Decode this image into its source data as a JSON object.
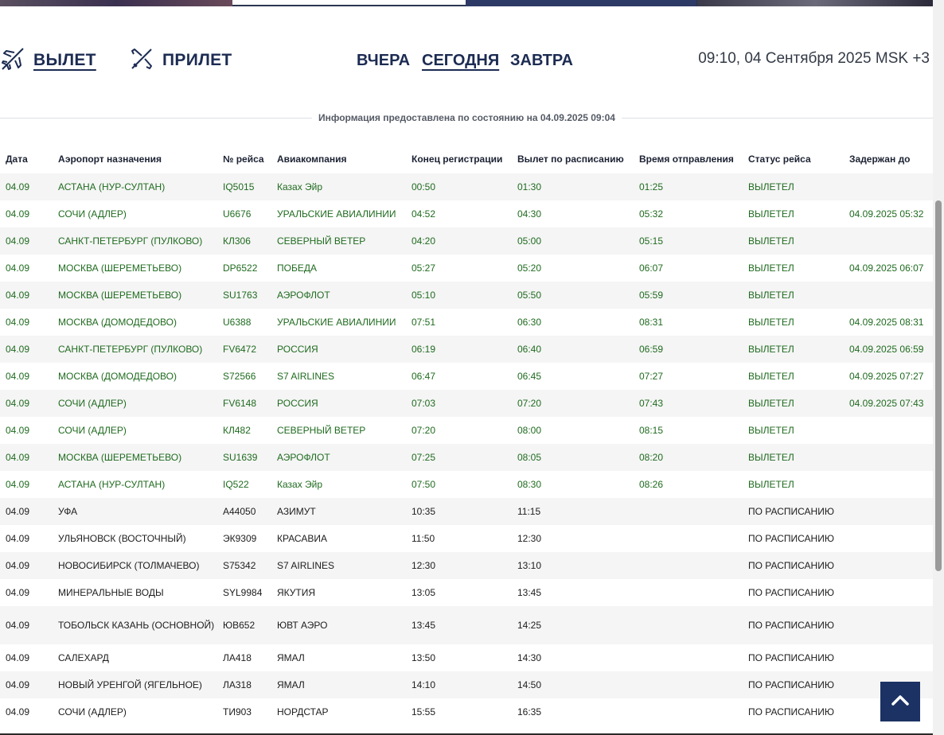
{
  "nav": {
    "departures_label": "ВЫЛЕТ",
    "arrivals_label": "ПРИЛЕТ",
    "days": {
      "yesterday": "ВЧЕРА",
      "today": "СЕГОДНЯ",
      "tomorrow": "ЗАВТРА"
    },
    "clock": "09:10, 04 Сентября 2025 MSK +3"
  },
  "info": "Информация предоставлена по состоянию на 04.09.2025 09:04",
  "table": {
    "headers": {
      "date": "Дата",
      "destination": "Аэропорт назначения",
      "flight": "№ рейса",
      "airline": "Авиакомпания",
      "checkin_end": "Конец регистрации",
      "scheduled": "Вылет по расписанию",
      "actual": "Время отправления",
      "status": "Статус рейса",
      "delayed": "Задержан до"
    },
    "rows": [
      {
        "date": "04.09",
        "destination": "АСТАНА (НУР-СУЛТАН)",
        "flight": "IQ5015",
        "airline": "Казах Эйр",
        "checkin_end": "00:50",
        "scheduled": "01:30",
        "actual": "01:25",
        "status": "ВЫЛЕТЕЛ",
        "delayed": "",
        "departed": true
      },
      {
        "date": "04.09",
        "destination": "СОЧИ (АДЛЕР)",
        "flight": "U6676",
        "airline": "УРАЛЬСКИЕ АВИАЛИНИИ",
        "checkin_end": "04:52",
        "scheduled": "04:30",
        "actual": "05:32",
        "status": "ВЫЛЕТЕЛ",
        "delayed": "04.09.2025 05:32",
        "departed": true
      },
      {
        "date": "04.09",
        "destination": "САНКТ-ПЕТЕРБУРГ (ПУЛКОВО)",
        "flight": "КЛ306",
        "airline": "СЕВЕРНЫЙ ВЕТЕР",
        "checkin_end": "04:20",
        "scheduled": "05:00",
        "actual": "05:15",
        "status": "ВЫЛЕТЕЛ",
        "delayed": "",
        "departed": true
      },
      {
        "date": "04.09",
        "destination": "МОСКВА (ШЕРЕМЕТЬЕВО)",
        "flight": "DP6522",
        "airline": "ПОБЕДА",
        "checkin_end": "05:27",
        "scheduled": "05:20",
        "actual": "06:07",
        "status": "ВЫЛЕТЕЛ",
        "delayed": "04.09.2025 06:07",
        "departed": true
      },
      {
        "date": "04.09",
        "destination": "МОСКВА (ШЕРЕМЕТЬЕВО)",
        "flight": "SU1763",
        "airline": "АЭРОФЛОТ",
        "checkin_end": "05:10",
        "scheduled": "05:50",
        "actual": "05:59",
        "status": "ВЫЛЕТЕЛ",
        "delayed": "",
        "departed": true
      },
      {
        "date": "04.09",
        "destination": "МОСКВА (ДОМОДЕДОВО)",
        "flight": "U6388",
        "airline": "УРАЛЬСКИЕ АВИАЛИНИИ",
        "checkin_end": "07:51",
        "scheduled": "06:30",
        "actual": "08:31",
        "status": "ВЫЛЕТЕЛ",
        "delayed": "04.09.2025 08:31",
        "departed": true
      },
      {
        "date": "04.09",
        "destination": "САНКТ-ПЕТЕРБУРГ (ПУЛКОВО)",
        "flight": "FV6472",
        "airline": "РОССИЯ",
        "checkin_end": "06:19",
        "scheduled": "06:40",
        "actual": "06:59",
        "status": "ВЫЛЕТЕЛ",
        "delayed": "04.09.2025 06:59",
        "departed": true
      },
      {
        "date": "04.09",
        "destination": "МОСКВА (ДОМОДЕДОВО)",
        "flight": "S72566",
        "airline": "S7 AIRLINES",
        "checkin_end": "06:47",
        "scheduled": "06:45",
        "actual": "07:27",
        "status": "ВЫЛЕТЕЛ",
        "delayed": "04.09.2025 07:27",
        "departed": true
      },
      {
        "date": "04.09",
        "destination": "СОЧИ (АДЛЕР)",
        "flight": "FV6148",
        "airline": "РОССИЯ",
        "checkin_end": "07:03",
        "scheduled": "07:20",
        "actual": "07:43",
        "status": "ВЫЛЕТЕЛ",
        "delayed": "04.09.2025 07:43",
        "departed": true
      },
      {
        "date": "04.09",
        "destination": "СОЧИ (АДЛЕР)",
        "flight": "КЛ482",
        "airline": "СЕВЕРНЫЙ ВЕТЕР",
        "checkin_end": "07:20",
        "scheduled": "08:00",
        "actual": "08:15",
        "status": "ВЫЛЕТЕЛ",
        "delayed": "",
        "departed": true
      },
      {
        "date": "04.09",
        "destination": "МОСКВА (ШЕРЕМЕТЬЕВО)",
        "flight": "SU1639",
        "airline": "АЭРОФЛОТ",
        "checkin_end": "07:25",
        "scheduled": "08:05",
        "actual": "08:20",
        "status": "ВЫЛЕТЕЛ",
        "delayed": "",
        "departed": true
      },
      {
        "date": "04.09",
        "destination": "АСТАНА (НУР-СУЛТАН)",
        "flight": "IQ522",
        "airline": "Казах Эйр",
        "checkin_end": "07:50",
        "scheduled": "08:30",
        "actual": "08:26",
        "status": "ВЫЛЕТЕЛ",
        "delayed": "",
        "departed": true
      },
      {
        "date": "04.09",
        "destination": "УФА",
        "flight": "А44050",
        "airline": "АЗИМУТ",
        "checkin_end": "10:35",
        "scheduled": "11:15",
        "actual": "",
        "status": "ПО РАСПИСАНИЮ",
        "delayed": "",
        "departed": false
      },
      {
        "date": "04.09",
        "destination": "УЛЬЯНОВСК (ВОСТОЧНЫЙ)",
        "flight": "ЭК9309",
        "airline": "КРАСАВИА",
        "checkin_end": "11:50",
        "scheduled": "12:30",
        "actual": "",
        "status": "ПО РАСПИСАНИЮ",
        "delayed": "",
        "departed": false
      },
      {
        "date": "04.09",
        "destination": "НОВОСИБИРСК (ТОЛМАЧЕВО)",
        "flight": "S75342",
        "airline": "S7 AIRLINES",
        "checkin_end": "12:30",
        "scheduled": "13:10",
        "actual": "",
        "status": "ПО РАСПИСАНИЮ",
        "delayed": "",
        "departed": false
      },
      {
        "date": "04.09",
        "destination": "МИНЕРАЛЬНЫЕ ВОДЫ",
        "flight": "SYL9984",
        "airline": "ЯКУТИЯ",
        "checkin_end": "13:05",
        "scheduled": "13:45",
        "actual": "",
        "status": "ПО РАСПИСАНИЮ",
        "delayed": "",
        "departed": false
      },
      {
        "date": "04.09",
        "destination": "ТОБОЛЬСК КАЗАНЬ (ОСНОВНОЙ)",
        "flight": "ЮВ652",
        "airline": "ЮВТ АЭРО",
        "checkin_end": "13:45",
        "scheduled": "14:25",
        "actual": "",
        "status": "ПО РАСПИСАНИЮ",
        "delayed": "",
        "departed": false,
        "tall": true
      },
      {
        "date": "04.09",
        "destination": "САЛЕХАРД",
        "flight": "ЛА418",
        "airline": "ЯМАЛ",
        "checkin_end": "13:50",
        "scheduled": "14:30",
        "actual": "",
        "status": "ПО РАСПИСАНИЮ",
        "delayed": "",
        "departed": false
      },
      {
        "date": "04.09",
        "destination": "НОВЫЙ УРЕНГОЙ (ЯГЕЛЬНОЕ)",
        "flight": "ЛА318",
        "airline": "ЯМАЛ",
        "checkin_end": "14:10",
        "scheduled": "14:50",
        "actual": "",
        "status": "ПО РАСПИСАНИЮ",
        "delayed": "",
        "departed": false
      },
      {
        "date": "04.09",
        "destination": "СОЧИ (АДЛЕР)",
        "flight": "ТИ903",
        "airline": "НОРДСТАР",
        "checkin_end": "15:55",
        "scheduled": "16:35",
        "actual": "",
        "status": "ПО РАСПИСАНИЮ",
        "delayed": "",
        "departed": false
      }
    ]
  },
  "icons": {
    "departures": "plane-takeoff-icon",
    "arrivals": "plane-landing-icon",
    "scroll_top": "chevron-up-icon"
  },
  "colors": {
    "brand_navy": "#1c2b52",
    "departed_green": "#1f6b1f",
    "scroll_top_bg": "#1c3264"
  }
}
